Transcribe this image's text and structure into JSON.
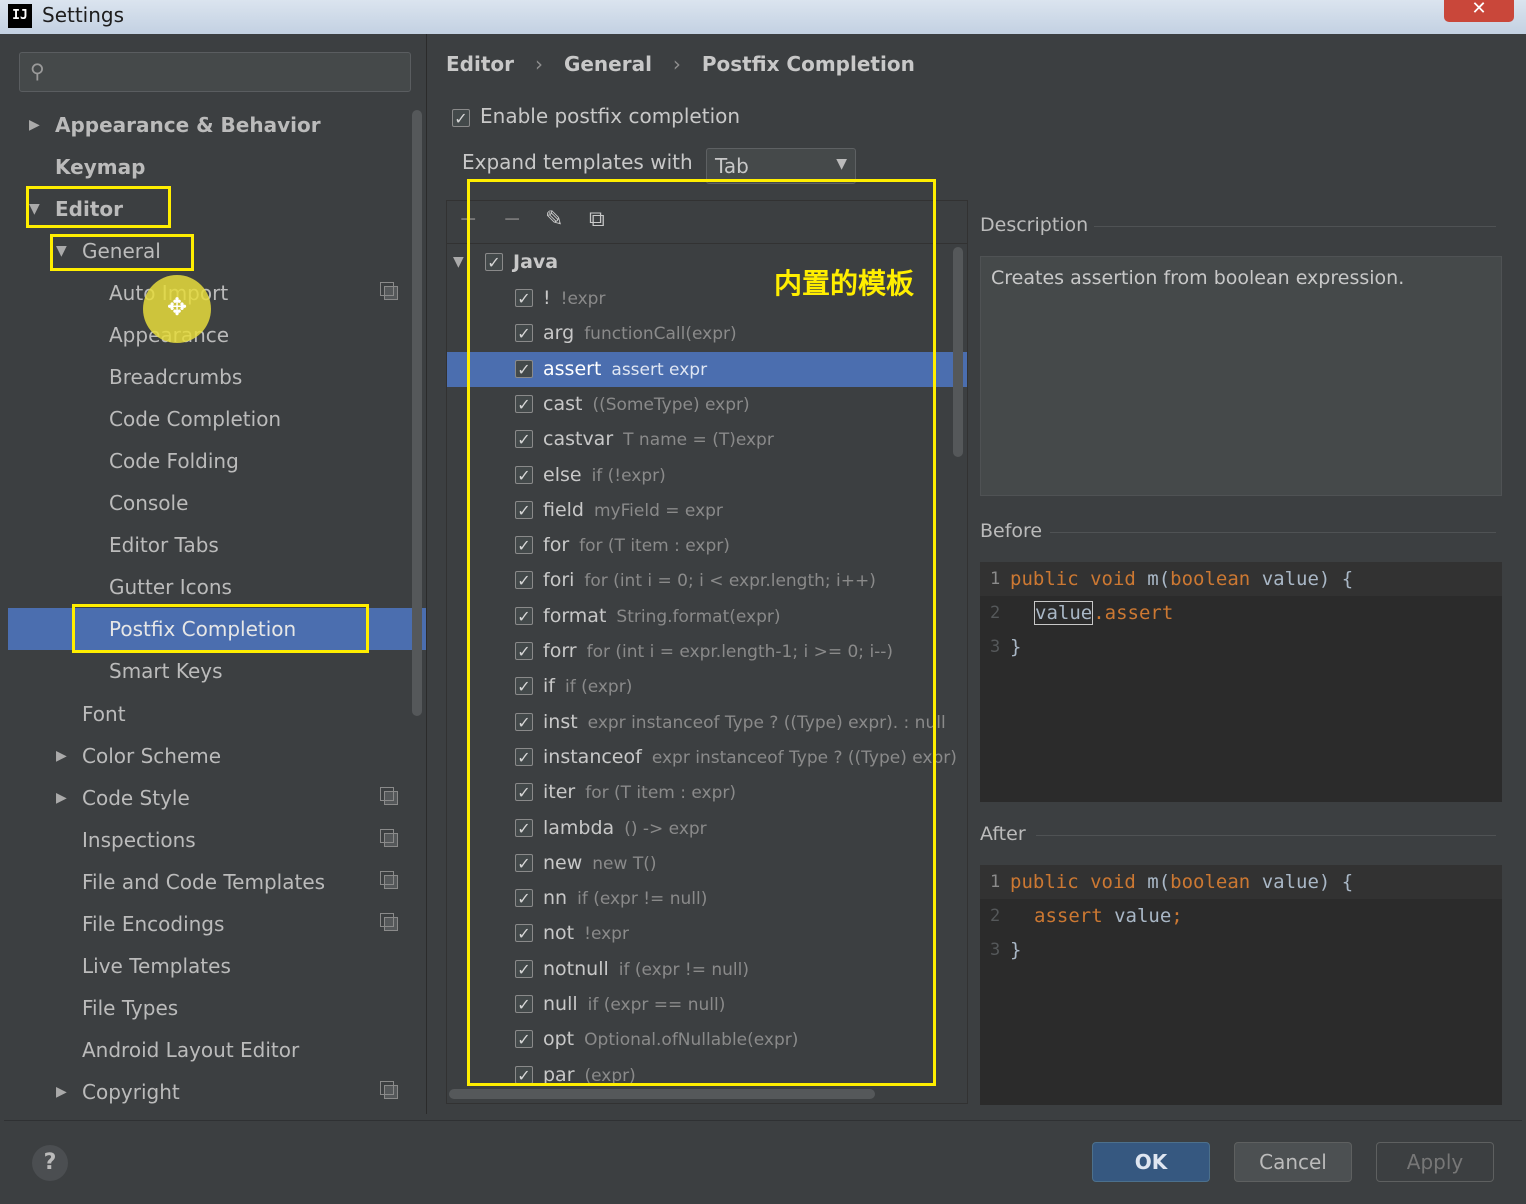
{
  "window": {
    "title": "Settings",
    "close_symbol": "✕",
    "app_icon_text": "IJ"
  },
  "search": {
    "placeholder": "",
    "icon": "search-icon"
  },
  "sidebar": {
    "items": [
      {
        "label": "Appearance & Behavior",
        "arrow": "▶",
        "bold": true
      },
      {
        "label": "Keymap",
        "bold": true
      },
      {
        "label": "Editor",
        "arrow": "▼",
        "bold": true
      },
      {
        "label": "General",
        "arrow": "▼"
      },
      {
        "label": "Auto Import",
        "copy_icon": true
      },
      {
        "label": "Appearance"
      },
      {
        "label": "Breadcrumbs"
      },
      {
        "label": "Code Completion"
      },
      {
        "label": "Code Folding"
      },
      {
        "label": "Console"
      },
      {
        "label": "Editor Tabs"
      },
      {
        "label": "Gutter Icons"
      },
      {
        "label": "Postfix Completion",
        "selected": true
      },
      {
        "label": "Smart Keys"
      },
      {
        "label": "Font"
      },
      {
        "label": "Color Scheme",
        "arrow": "▶"
      },
      {
        "label": "Code Style",
        "arrow": "▶",
        "copy_icon": true
      },
      {
        "label": "Inspections",
        "copy_icon": true
      },
      {
        "label": "File and Code Templates",
        "copy_icon": true
      },
      {
        "label": "File Encodings",
        "copy_icon": true
      },
      {
        "label": "Live Templates"
      },
      {
        "label": "File Types"
      },
      {
        "label": "Android Layout Editor"
      },
      {
        "label": "Copyright",
        "arrow": "▶",
        "copy_icon": true
      }
    ]
  },
  "breadcrumb": [
    "Editor",
    "General",
    "Postfix Completion"
  ],
  "breadcrumb_separator": "›",
  "enable_postfix": {
    "label": "Enable postfix completion",
    "checked": true
  },
  "expand_templates": {
    "label": "Expand templates with",
    "value": "Tab"
  },
  "toolbar": {
    "add": "+",
    "remove": "−",
    "edit": "✎",
    "copy": "⧉"
  },
  "templates": {
    "group": "Java",
    "items": [
      {
        "key": "!",
        "example": "!expr"
      },
      {
        "key": "arg",
        "example": "functionCall(expr)"
      },
      {
        "key": "assert",
        "example": "assert expr",
        "selected": true
      },
      {
        "key": "cast",
        "example": "((SomeType) expr)"
      },
      {
        "key": "castvar",
        "example": "T name = (T)expr"
      },
      {
        "key": "else",
        "example": "if (!expr)"
      },
      {
        "key": "field",
        "example": "myField = expr"
      },
      {
        "key": "for",
        "example": "for (T item : expr)"
      },
      {
        "key": "fori",
        "example": "for (int i = 0; i < expr.length; i++)"
      },
      {
        "key": "format",
        "example": "String.format(expr)"
      },
      {
        "key": "forr",
        "example": "for (int i = expr.length-1; i >= 0; i--)"
      },
      {
        "key": "if",
        "example": "if (expr)"
      },
      {
        "key": "inst",
        "example": "expr instanceof Type ? ((Type) expr). : null"
      },
      {
        "key": "instanceof",
        "example": "expr instanceof Type ? ((Type) expr)"
      },
      {
        "key": "iter",
        "example": "for (T item : expr)"
      },
      {
        "key": "lambda",
        "example": "() -> expr"
      },
      {
        "key": "new",
        "example": "new T()"
      },
      {
        "key": "nn",
        "example": "if (expr != null)"
      },
      {
        "key": "not",
        "example": "!expr"
      },
      {
        "key": "notnull",
        "example": "if (expr != null)"
      },
      {
        "key": "null",
        "example": "if (expr == null)"
      },
      {
        "key": "opt",
        "example": "Optional.ofNullable(expr)"
      },
      {
        "key": "par",
        "example": "(expr)"
      }
    ]
  },
  "annotation": "内置的模板",
  "description": {
    "label": "Description",
    "text": "Creates assertion from boolean expression."
  },
  "before": {
    "label": "Before",
    "lines": [
      {
        "n": "1",
        "tokens": [
          [
            "public void ",
            "kw"
          ],
          [
            "m(",
            ""
          ],
          [
            "boolean",
            "kw"
          ],
          [
            " value) {",
            ""
          ]
        ]
      },
      {
        "n": "2",
        "tokens": [
          [
            "value",
            "box"
          ],
          [
            ".assert",
            "kw"
          ]
        ]
      },
      {
        "n": "3",
        "tokens": [
          [
            "}",
            ""
          ]
        ]
      }
    ]
  },
  "after": {
    "label": "After",
    "lines": [
      {
        "n": "1",
        "tokens": [
          [
            "public void ",
            "kw"
          ],
          [
            "m(",
            ""
          ],
          [
            "boolean",
            "kw"
          ],
          [
            " value) {",
            ""
          ]
        ]
      },
      {
        "n": "2",
        "tokens": [
          [
            "assert",
            "kw"
          ],
          [
            " value",
            ""
          ],
          [
            ";",
            "kw"
          ]
        ]
      },
      {
        "n": "3",
        "tokens": [
          [
            "}",
            ""
          ]
        ]
      }
    ]
  },
  "buttons": {
    "help": "?",
    "ok": "OK",
    "cancel": "Cancel",
    "apply": "Apply"
  },
  "colors": {
    "accent": "#4b6eaf",
    "highlight": "#ffee00",
    "keyword": "#cc7832"
  }
}
